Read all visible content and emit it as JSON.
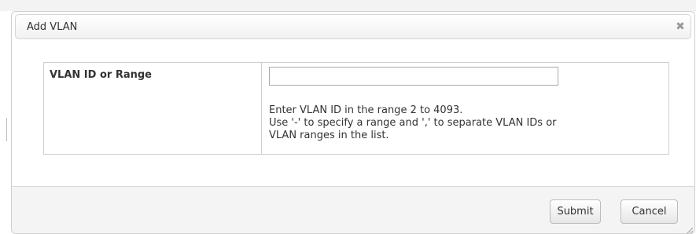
{
  "dialog": {
    "title": "Add VLAN",
    "close_icon": "close-icon",
    "close_glyph": "✖"
  },
  "form": {
    "vlan_label": "VLAN ID or Range",
    "vlan_value": "",
    "help_lines": [
      "Enter VLAN ID in the range 2 to 4093.",
      "Use '-' to specify a range and ',' to separate VLAN IDs or",
      "VLAN ranges in the list."
    ]
  },
  "footer": {
    "submit_label": "Submit",
    "cancel_label": "Cancel"
  }
}
